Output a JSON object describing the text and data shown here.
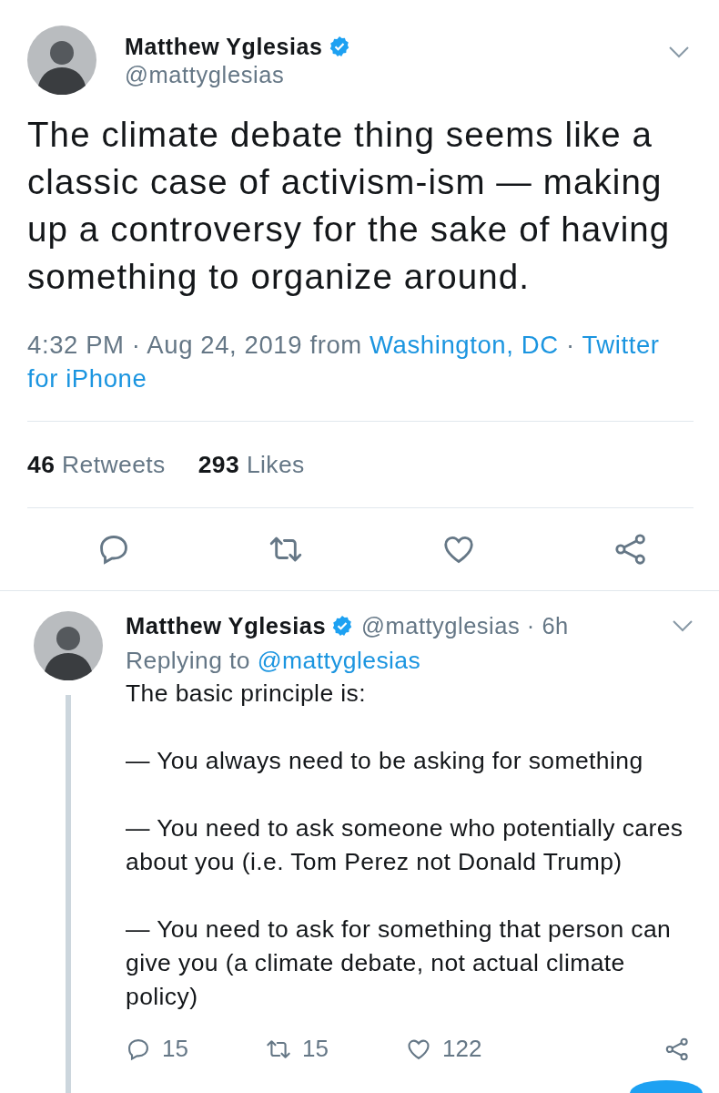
{
  "tweet": {
    "author": {
      "name": "Matthew Yglesias",
      "handle": "@mattyglesias",
      "verified": true
    },
    "text": "The climate debate thing seems like a classic case of activism-ism — making up a controversy for the sake of having something to organize around.",
    "meta": [
      {
        "text": "4:32 PM · Aug 24, 2019 from ",
        "kind": "plain"
      },
      {
        "text": "Washington, DC",
        "kind": "link"
      },
      {
        "text": " · ",
        "kind": "plain"
      },
      {
        "text": "Twitter for iPhone",
        "kind": "link"
      }
    ],
    "stats": [
      {
        "count": "46",
        "label": "Retweets"
      },
      {
        "count": "293",
        "label": "Likes"
      }
    ]
  },
  "reply": {
    "author": {
      "name": "Matthew Yglesias",
      "handle": "@mattyglesias · 6h",
      "verified": true
    },
    "replying_to": {
      "prefix": "Replying to ",
      "handle": "@mattyglesias"
    },
    "paragraphs": [
      "The basic principle is:",
      "— You always need to be asking for something",
      "— You need to ask someone who potentially cares about you (i.e. Tom Perez not Donald Trump)",
      "— You need to ask for something that person can give you (a climate debate, not actual climate policy)"
    ],
    "actions": [
      {
        "kind": "reply",
        "count": "15"
      },
      {
        "kind": "retweet",
        "count": "15"
      },
      {
        "kind": "like",
        "count": "122"
      },
      {
        "kind": "share"
      }
    ]
  }
}
